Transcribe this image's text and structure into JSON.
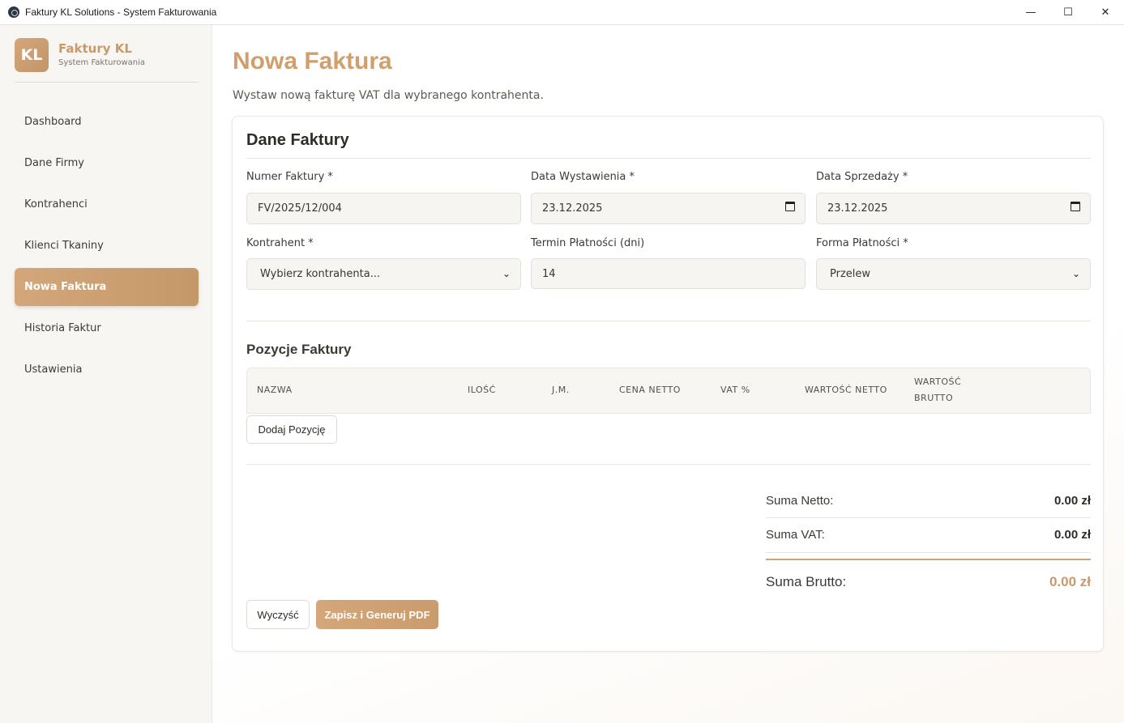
{
  "window": {
    "title": "Faktury KL Solutions - System Fakturowania",
    "minimize": "—",
    "maximize": "☐",
    "close": "✕"
  },
  "brand": {
    "logo": "KL",
    "name": "Faktury KL",
    "subtitle": "System Fakturowania"
  },
  "sidebar": {
    "items": [
      {
        "label": "Dashboard"
      },
      {
        "label": "Dane Firmy"
      },
      {
        "label": "Kontrahenci"
      },
      {
        "label": "Klienci Tkaniny"
      },
      {
        "label": "Nowa Faktura",
        "active": true
      },
      {
        "label": "Historia Faktur"
      },
      {
        "label": "Ustawienia"
      }
    ]
  },
  "page": {
    "title": "Nowa Faktura",
    "subtitle": "Wystaw nową fakturę VAT dla wybranego kontrahenta."
  },
  "form": {
    "title": "Dane Faktury",
    "invoice_number": {
      "label": "Numer Faktury *",
      "value": "FV/2025/12/004"
    },
    "issue_date": {
      "label": "Data Wystawienia *",
      "value": "23.12.2025"
    },
    "sale_date": {
      "label": "Data Sprzedaży *",
      "value": "23.12.2025"
    },
    "contractor": {
      "label": "Kontrahent *",
      "value": "Wybierz kontrahenta..."
    },
    "payment_term": {
      "label": "Termin Płatności (dni)",
      "value": "14"
    },
    "payment_method": {
      "label": "Forma Płatności *",
      "value": "Przelew"
    }
  },
  "items": {
    "title": "Pozycje Faktury",
    "columns": [
      "NAZWA",
      "ILOŚĆ",
      "J.M.",
      "CENA NETTO",
      "VAT %",
      "WARTOŚĆ NETTO",
      "WARTOŚĆ",
      "BRUTTO"
    ],
    "add_button": "Dodaj Pozycję"
  },
  "summary": {
    "net_label": "Suma Netto:",
    "net_value": "0.00 zł",
    "vat_label": "Suma VAT:",
    "vat_value": "0.00 zł",
    "gross_label": "Suma Brutto:",
    "gross_value": "0.00 zł"
  },
  "actions": {
    "clear": "Wyczyść",
    "save": "Zapisz i Generuj PDF"
  },
  "colors": {
    "accent": "#d19e6d",
    "sidebar_bg": "#f7f6f3"
  }
}
